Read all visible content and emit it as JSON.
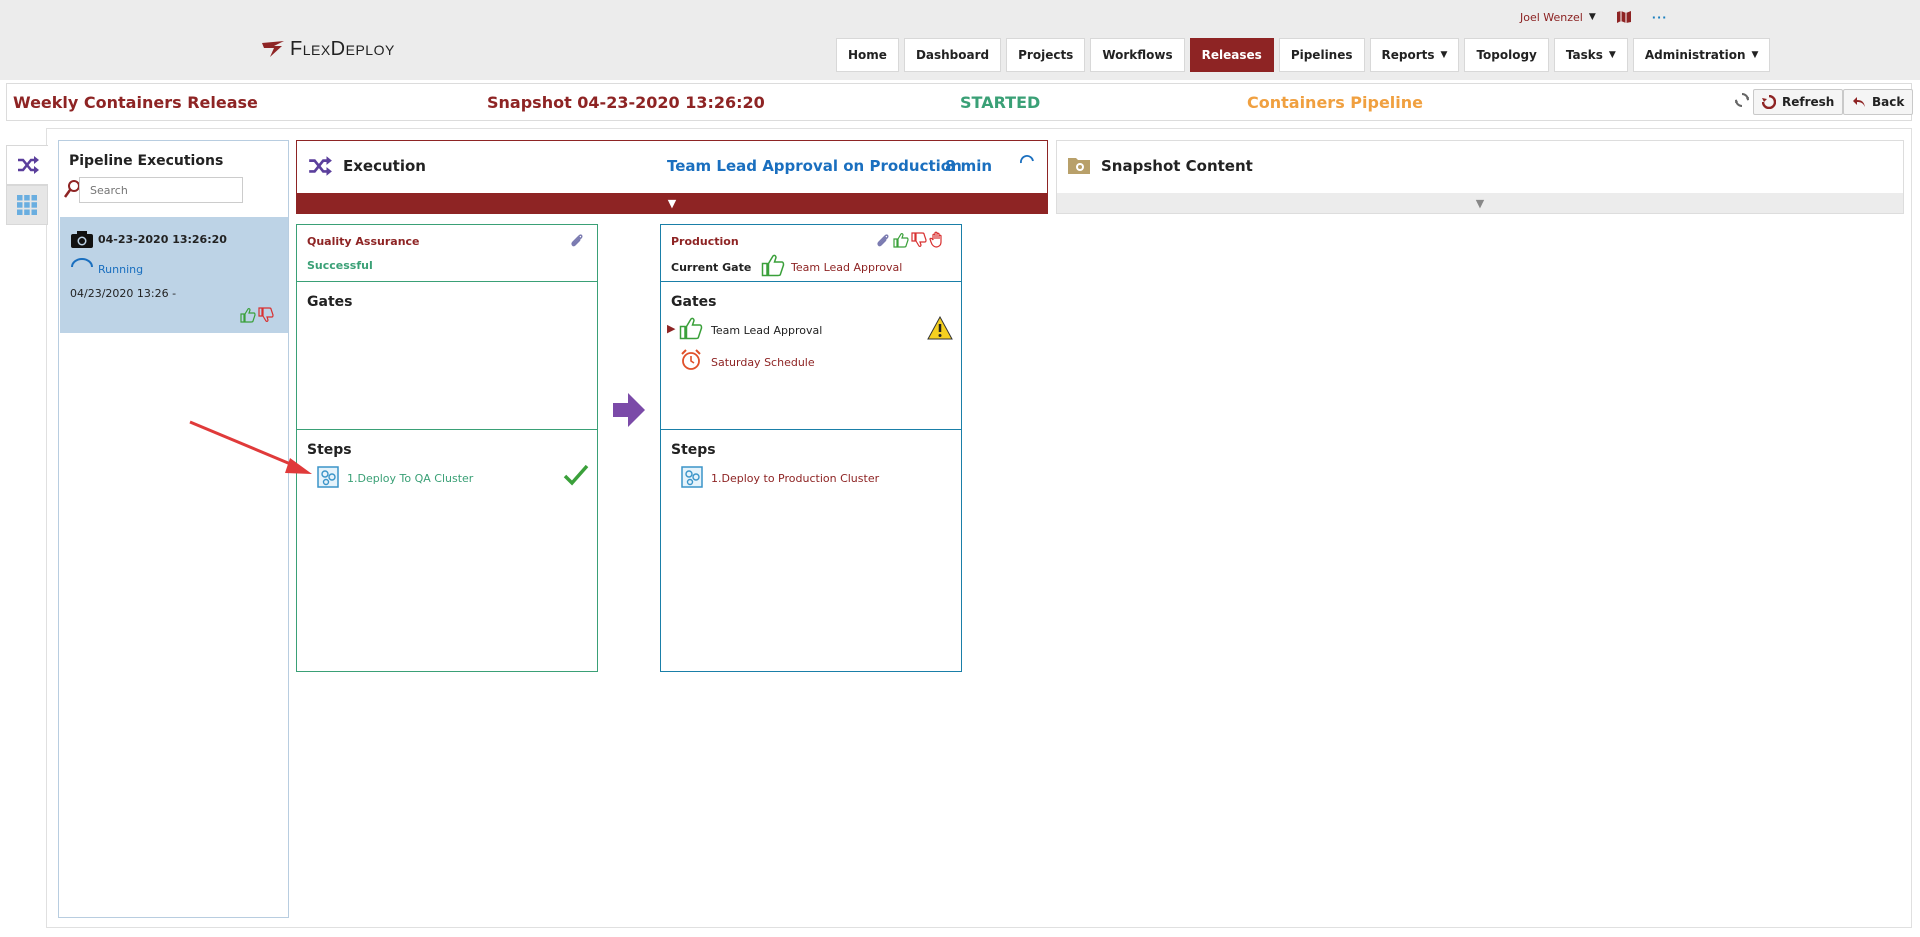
{
  "app": {
    "brand": "FlexDeploy"
  },
  "user": {
    "name": "Joel Wenzel"
  },
  "nav": {
    "items": [
      {
        "label": "Home"
      },
      {
        "label": "Dashboard"
      },
      {
        "label": "Projects"
      },
      {
        "label": "Workflows"
      },
      {
        "label": "Releases"
      },
      {
        "label": "Pipelines"
      },
      {
        "label": "Reports"
      },
      {
        "label": "Topology"
      },
      {
        "label": "Tasks"
      },
      {
        "label": "Administration"
      }
    ]
  },
  "header": {
    "release": "Weekly Containers Release",
    "snapshot": "Snapshot 04-23-2020 13:26:20",
    "status": "STARTED",
    "pipeline": "Containers Pipeline",
    "refresh_label": "Refresh",
    "back_label": "Back"
  },
  "executions": {
    "title": "Pipeline Executions",
    "search_placeholder": "Search",
    "items": [
      {
        "date": "04-23-2020 13:26:20",
        "state": "Running",
        "time": "04/23/2020 13:26  -"
      }
    ]
  },
  "execution_header": {
    "label": "Execution",
    "gate": "Team Lead Approval on Production",
    "duration": "8 min"
  },
  "snapshot_content": {
    "label": "Snapshot Content"
  },
  "stages": {
    "qa": {
      "name": "Quality Assurance",
      "status": "Successful",
      "gates_title": "Gates",
      "steps_title": "Steps",
      "steps": [
        "1.Deploy To QA Cluster"
      ]
    },
    "prod": {
      "name": "Production",
      "current_gate_label": "Current Gate",
      "current_gate": "Team Lead Approval",
      "gates_title": "Gates",
      "gates": [
        "Team Lead Approval",
        "Saturday Schedule"
      ],
      "steps_title": "Steps",
      "steps": [
        "1.Deploy to Production Cluster"
      ]
    }
  },
  "colors": {
    "brand_red": "#8e2424",
    "success_green": "#3aa076",
    "link_blue": "#1a6fbf",
    "pipeline_orange": "#f0a040"
  }
}
